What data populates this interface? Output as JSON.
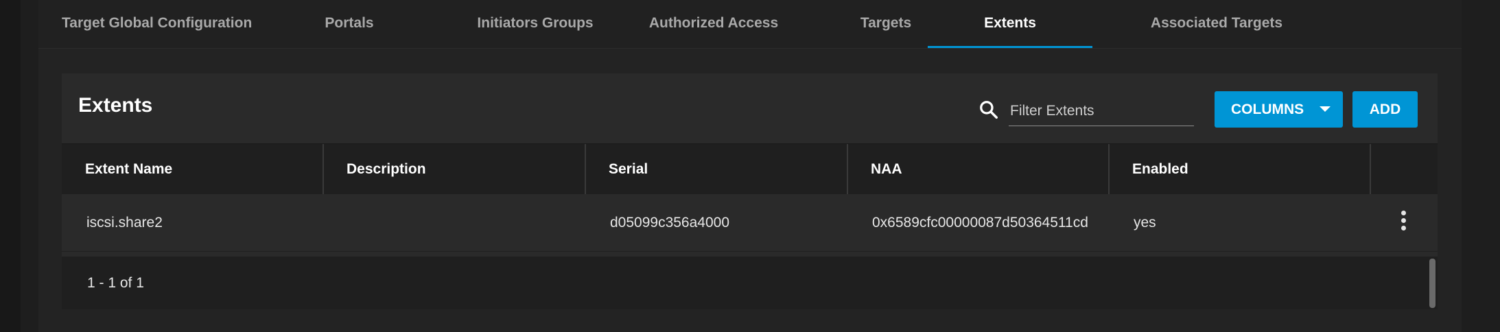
{
  "tabs": [
    {
      "label": "Target Global Configuration",
      "active": false
    },
    {
      "label": "Portals",
      "active": false
    },
    {
      "label": "Initiators Groups",
      "active": false
    },
    {
      "label": "Authorized Access",
      "active": false
    },
    {
      "label": "Targets",
      "active": false
    },
    {
      "label": "Extents",
      "active": true
    },
    {
      "label": "Associated Targets",
      "active": false
    }
  ],
  "card": {
    "title": "Extents",
    "search": {
      "placeholder": "Filter Extents",
      "value": ""
    },
    "columns_button": "COLUMNS",
    "add_button": "ADD"
  },
  "table": {
    "headers": [
      "Extent Name",
      "Description",
      "Serial",
      "NAA",
      "Enabled"
    ],
    "rows": [
      {
        "extent_name": "iscsi.share2",
        "description": "",
        "serial": "d05099c356a4000",
        "naa": "0x6589cfc00000087d50364511cd",
        "enabled": "yes"
      }
    ]
  },
  "pagination": "1 - 1 of 1",
  "colors": {
    "accent": "#0095d5",
    "background": "#1e1e1e",
    "card": "#2a2a2a"
  },
  "icons": {
    "search": "search-icon",
    "columns_dropdown": "chevron-down-icon",
    "row_actions": "more-vertical-icon"
  }
}
